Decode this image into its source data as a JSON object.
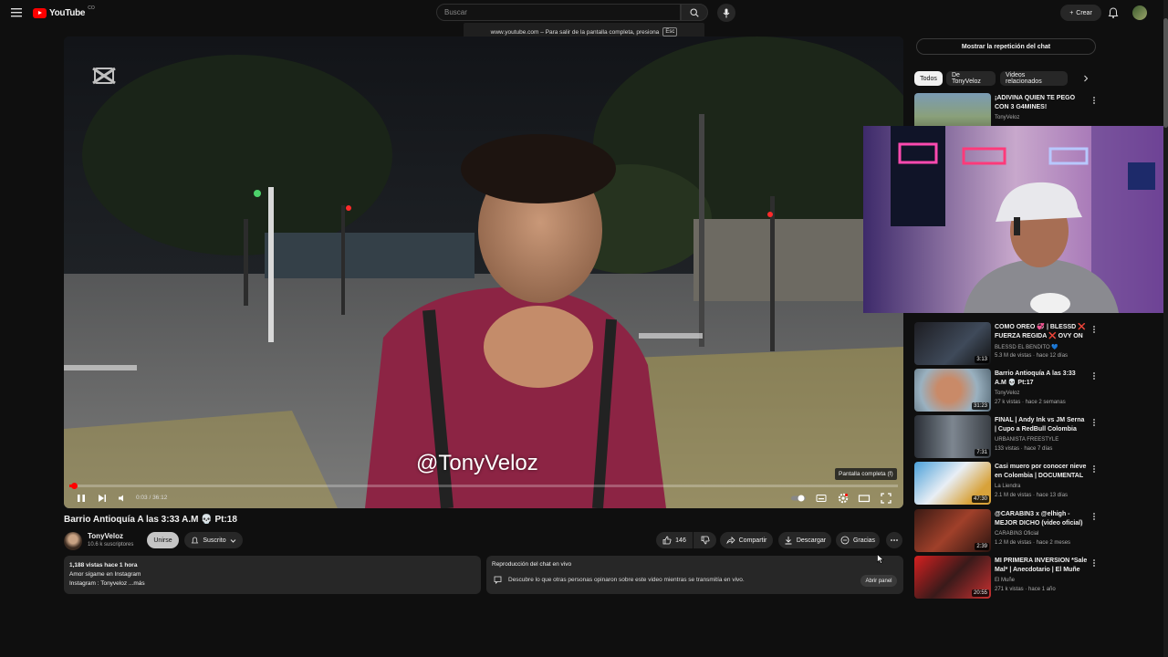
{
  "brand": {
    "logo_text": "YouTube",
    "logo_sup": "CO",
    "accent": "#ff0000"
  },
  "header": {
    "search_placeholder": "Buscar",
    "create_label": "Crear",
    "fullscreen_hint": "www.youtube.com – Para salir de la pantalla completa, presiona",
    "fullscreen_key": "Esc"
  },
  "player": {
    "watermark": "@TonyVeloz",
    "time": "0:03 / 36:12",
    "progress": 0.0014,
    "fullscreen_tooltip": "Pantalla completa (f)"
  },
  "video": {
    "title": "Barrio Antioquía A las 3:33 A.M 💀 Pt:18",
    "channel": "TonyVeloz",
    "subscribers": "10.6 k suscriptores",
    "join_label": "Unirse",
    "subscribed_label": "Suscrito",
    "likes": "146",
    "share_label": "Compartir",
    "download_label": "Descargar",
    "thanks_label": "Gracias"
  },
  "description": {
    "meta": "1,188 vistas  hace 1 hora",
    "line1": "Amor sígame en Instagram",
    "line2": "Instagram : Tonyveloz ...más"
  },
  "chat_replay": {
    "title": "Reproducción del chat en vivo",
    "desc": "Descubre lo que otras personas opinaron sobre este video mientras se transmitía en vivo.",
    "open_label": "Abrir panel"
  },
  "sidebar": {
    "chat_button": "Mostrar la repetición del chat",
    "chips": [
      "Todos",
      "De TonyVeloz",
      "Videos relacionados"
    ],
    "recs": [
      {
        "title": "¡ADIVINA QUIEN TE PEGÓ CON 3 G4MINES!",
        "channel": "TonyVeloz",
        "meta": "",
        "duration": ""
      },
      {
        "title": "COMO OREO 💞 | BLESSD ❌ FUERZA REGIDA ❌ OVY ON ...",
        "channel": "BLESSD EL BENDITO 💙",
        "meta": "5.3 M de vistas · hace 12 días",
        "duration": "3:13"
      },
      {
        "title": "Barrio Antioquía A las 3:33 A.M 💀 Pt:17",
        "channel": "TonyVeloz",
        "meta": "27 k vistas · hace 2 semanas",
        "duration": "31:23"
      },
      {
        "title": "FINAL | Andy Ink vs JM Serna | Cupo a RedBull Colombia 202...",
        "channel": "URBANISTA FREESTYLE",
        "meta": "133 vistas · hace 7 días",
        "duration": "7:31"
      },
      {
        "title": "Casi muero por conocer nieve en Colombia | DOCUMENTAL",
        "channel": "La Liendra",
        "meta": "2.1 M de vistas · hace 13 días",
        "duration": "47:30"
      },
      {
        "title": "@CARABIN3 x @elhigh - MEJOR DICHO (video oficial)",
        "channel": "CARABIN3 Oficial",
        "meta": "1.2 M de vistas · hace 2 meses",
        "duration": "2:39"
      },
      {
        "title": "MI PRIMERA INVERSION *Sale Mal* | Anecdotario | El Muñe",
        "channel": "El Muñe",
        "meta": "271 k vistas · hace 1 año",
        "duration": "20:55"
      }
    ]
  }
}
